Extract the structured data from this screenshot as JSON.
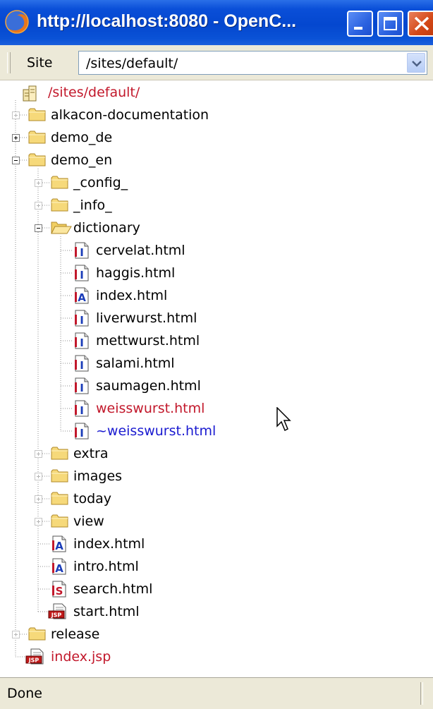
{
  "window": {
    "title": "http://localhost:8080 - OpenC..."
  },
  "toolbar": {
    "site_label": "Site",
    "site_value": "/sites/default/"
  },
  "tree": {
    "root": "/sites/default/",
    "nodes": [
      {
        "id": "alkacon-documentation",
        "label": "alkacon-documentation",
        "type": "folder",
        "level": 1,
        "expander": "plus-faint",
        "color": "black"
      },
      {
        "id": "demo_de",
        "label": "demo_de",
        "type": "folder",
        "level": 1,
        "expander": "plus",
        "color": "black"
      },
      {
        "id": "demo_en",
        "label": "demo_en",
        "type": "folder",
        "level": 1,
        "expander": "minus",
        "color": "black"
      },
      {
        "id": "_config_",
        "label": "_config_",
        "type": "folder",
        "level": 2,
        "expander": "plus-faint",
        "color": "black"
      },
      {
        "id": "_info_",
        "label": "_info_",
        "type": "folder",
        "level": 2,
        "expander": "plus-faint",
        "color": "black"
      },
      {
        "id": "dictionary",
        "label": "dictionary",
        "type": "folder-open",
        "level": 2,
        "expander": "minus",
        "color": "black"
      },
      {
        "id": "cervelat",
        "label": "cervelat.html",
        "type": "file-i",
        "level": 3,
        "color": "black"
      },
      {
        "id": "haggis",
        "label": "haggis.html",
        "type": "file-i",
        "level": 3,
        "color": "black"
      },
      {
        "id": "dict-index",
        "label": "index.html",
        "type": "file-a",
        "level": 3,
        "color": "black"
      },
      {
        "id": "liverwurst",
        "label": "liverwurst.html",
        "type": "file-i",
        "level": 3,
        "color": "black"
      },
      {
        "id": "mettwurst",
        "label": "mettwurst.html",
        "type": "file-i",
        "level": 3,
        "color": "black"
      },
      {
        "id": "salami",
        "label": "salami.html",
        "type": "file-i",
        "level": 3,
        "color": "black"
      },
      {
        "id": "saumagen",
        "label": "saumagen.html",
        "type": "file-i",
        "level": 3,
        "color": "black"
      },
      {
        "id": "weisswurst",
        "label": "weisswurst.html",
        "type": "file-i",
        "level": 3,
        "color": "red"
      },
      {
        "id": "weisswurst-tilde",
        "label": "~weisswurst.html",
        "type": "file-i",
        "level": 3,
        "color": "blue"
      },
      {
        "id": "extra",
        "label": "extra",
        "type": "folder",
        "level": 2,
        "expander": "plus-faint",
        "color": "black"
      },
      {
        "id": "images",
        "label": "images",
        "type": "folder",
        "level": 2,
        "expander": "plus-faint",
        "color": "black"
      },
      {
        "id": "today",
        "label": "today",
        "type": "folder",
        "level": 2,
        "expander": "plus-faint",
        "color": "black"
      },
      {
        "id": "view",
        "label": "view",
        "type": "folder",
        "level": 2,
        "expander": "plus-faint",
        "color": "black"
      },
      {
        "id": "en-index",
        "label": "index.html",
        "type": "file-a",
        "level": 2,
        "color": "black"
      },
      {
        "id": "intro",
        "label": "intro.html",
        "type": "file-a",
        "level": 2,
        "color": "black"
      },
      {
        "id": "search",
        "label": "search.html",
        "type": "file-s",
        "level": 2,
        "color": "black"
      },
      {
        "id": "start",
        "label": "start.html",
        "type": "file-jsp",
        "level": 2,
        "color": "black"
      },
      {
        "id": "release",
        "label": "release",
        "type": "folder",
        "level": 1,
        "expander": "plus-faint",
        "color": "black"
      },
      {
        "id": "index-jsp",
        "label": "index.jsp",
        "type": "file-jsp",
        "level": 1,
        "color": "red"
      }
    ]
  },
  "status": {
    "text": "Done"
  },
  "colors": {
    "titlebar": "#0447cf",
    "chrome": "#ece9d8",
    "red_text": "#c2182b",
    "blue_text": "#1a1ad0",
    "folder": "#f6d97a"
  }
}
